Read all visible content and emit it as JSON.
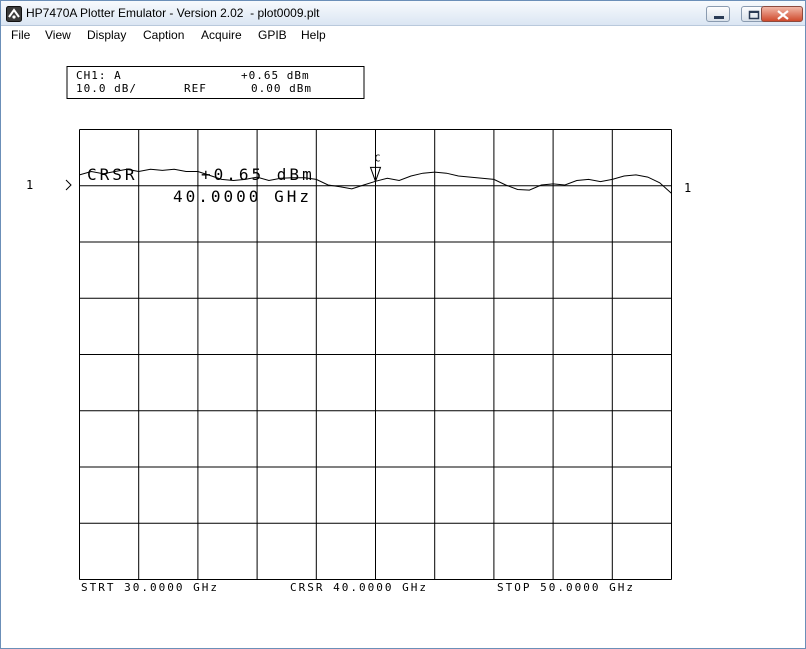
{
  "window": {
    "title": "HP7470A Plotter Emulator - Version 2.02  - plot0009.plt"
  },
  "menu": {
    "items": [
      "File",
      "View",
      "Display",
      "Caption",
      "Acquire",
      "GPIB",
      "Help"
    ]
  },
  "plot": {
    "header": {
      "line1_left": "CH1: A",
      "line1_right": "+0.65 dBm",
      "line2_left": "10.0 dB/",
      "line2_mid": "REF",
      "line2_right": "0.00 dBm"
    },
    "ref_marker_left": "1",
    "ref_marker_right": "1",
    "marker_label": "C",
    "cursor_label": "CRSR",
    "cursor_value": "+0.65 dBm",
    "cursor_freq": "40.0000 GHz",
    "footer": {
      "start": "STRT 30.0000 GHz",
      "cursor": "CRSR 40.0000 GHz",
      "stop": "STOP 50.0000 GHz"
    }
  },
  "chart_data": {
    "type": "line",
    "xlim": [
      30,
      50
    ],
    "ylim": [
      -80,
      0
    ],
    "x": [
      30,
      30.4,
      30.8,
      31.2,
      31.6,
      32,
      32.4,
      32.8,
      33.2,
      33.6,
      34,
      34.4,
      34.8,
      35.2,
      35.6,
      36,
      36.4,
      36.8,
      37.2,
      37.6,
      38,
      38.4,
      38.8,
      39.2,
      39.6,
      40,
      40.4,
      40.8,
      41.2,
      41.6,
      42,
      42.4,
      42.8,
      43.2,
      43.6,
      44,
      44.4,
      44.8,
      45.2,
      45.6,
      46,
      46.4,
      46.8,
      47.2,
      47.6,
      48,
      48.4,
      48.8,
      49.2,
      49.6,
      50
    ],
    "series": [
      {
        "values": [
          1.8,
          2.4,
          2.0,
          2.4,
          2.8,
          2.4,
          2.8,
          2.6,
          2.8,
          2.4,
          2.4,
          1.7,
          1.0,
          0.8,
          1.0,
          1.4,
          0.8,
          1.2,
          1.3,
          1.3,
          1.0,
          0.0,
          -0.3,
          -0.7,
          0.0,
          0.65,
          1.2,
          0.8,
          1.6,
          2.1,
          2.3,
          2.1,
          1.6,
          1.4,
          1.2,
          1.0,
          0.0,
          -0.8,
          -0.9,
          0.0,
          0.2,
          0.0,
          0.8,
          1.0,
          0.6,
          1.0,
          1.6,
          1.8,
          1.4,
          0.4,
          -1.5
        ]
      }
    ]
  }
}
